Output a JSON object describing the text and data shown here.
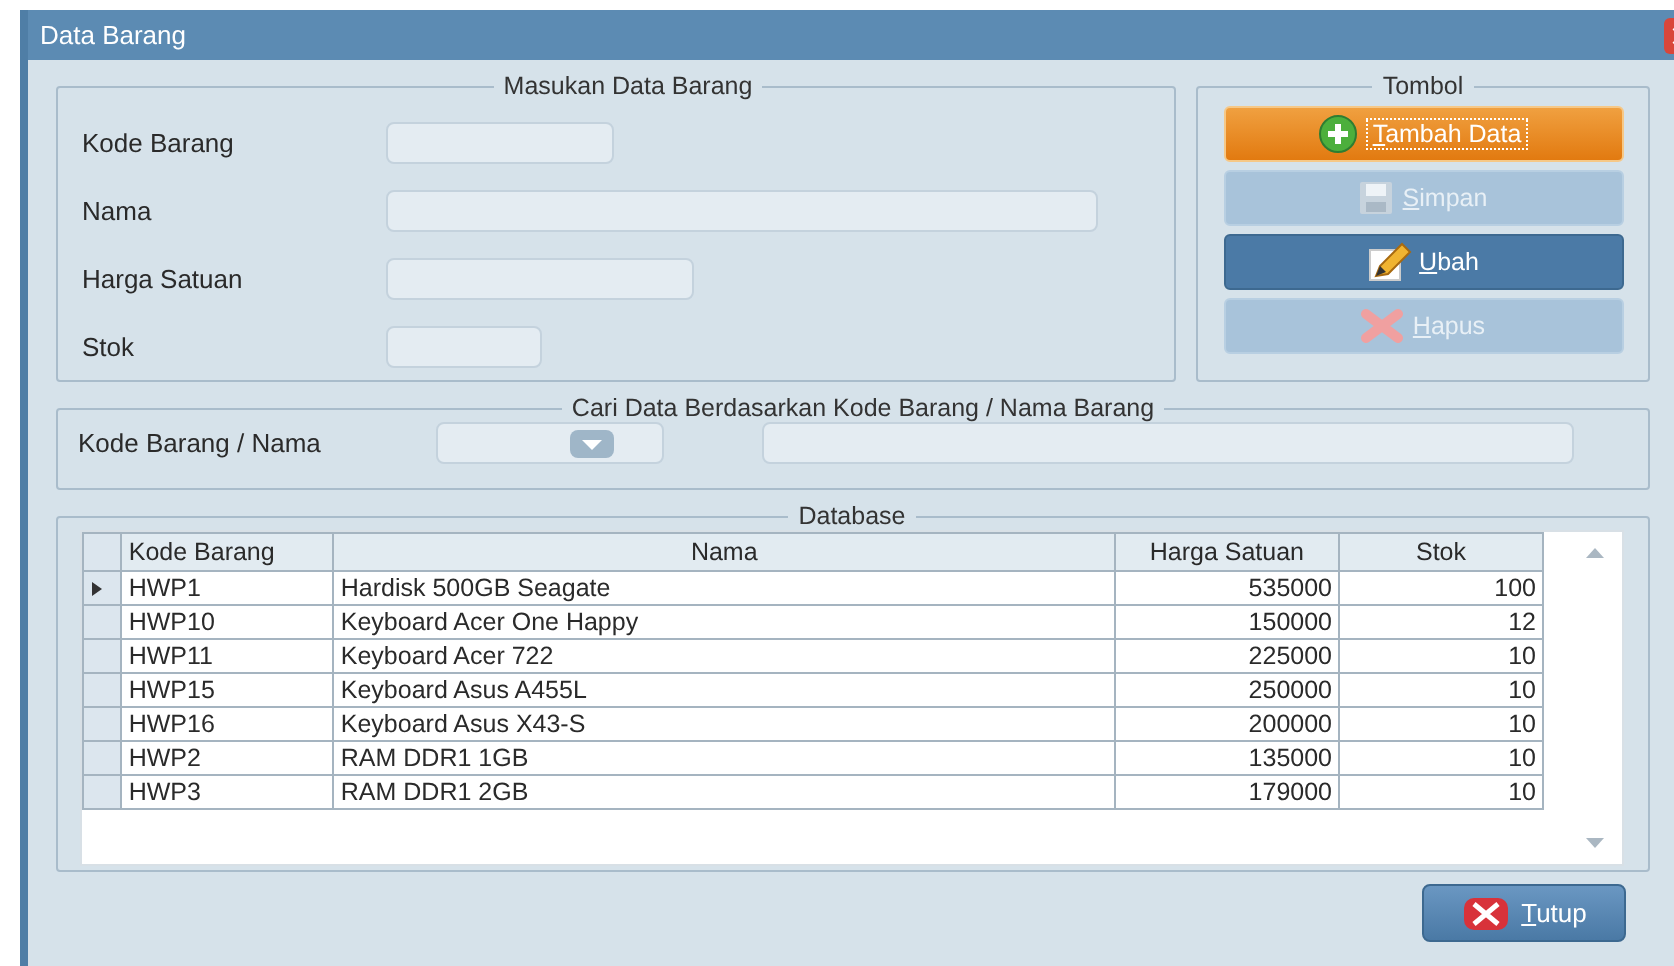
{
  "window": {
    "title": "Data Barang"
  },
  "input_group": {
    "title": "Masukan Data Barang",
    "fields": [
      {
        "label": "Kode Barang"
      },
      {
        "label": "Nama"
      },
      {
        "label": "Harga Satuan"
      },
      {
        "label": "Stok"
      }
    ]
  },
  "button_group": {
    "title": "Tombol",
    "buttons": [
      {
        "label": "Tambah Data",
        "highlighted": true,
        "disabled": false
      },
      {
        "label": "Simpan",
        "highlighted": false,
        "disabled": true
      },
      {
        "label": "Ubah",
        "highlighted": false,
        "disabled": false
      },
      {
        "label": "Hapus",
        "highlighted": false,
        "disabled": true
      }
    ]
  },
  "search_group": {
    "title": "Cari Data Berdasarkan Kode Barang / Nama Barang",
    "label": "Kode Barang / Nama"
  },
  "database": {
    "title": "Database",
    "columns": [
      "Kode Barang",
      "Nama",
      "Harga Satuan",
      "Stok"
    ],
    "rows": [
      {
        "cells": [
          "HWP1",
          "Hardisk 500GB Seagate",
          "535000",
          "100"
        ],
        "selected": true
      },
      {
        "cells": [
          "HWP10",
          "Keyboard Acer One Happy",
          "150000",
          "12"
        ],
        "selected": false
      },
      {
        "cells": [
          "HWP11",
          "Keyboard Acer 722",
          "225000",
          "10"
        ],
        "selected": false
      },
      {
        "cells": [
          "HWP15",
          "Keyboard Asus A455L",
          "250000",
          "10"
        ],
        "selected": false
      },
      {
        "cells": [
          "HWP16",
          "Keyboard Asus X43-S",
          "200000",
          "10"
        ],
        "selected": false
      },
      {
        "cells": [
          "HWP2",
          "RAM DDR1 1GB",
          "135000",
          "10"
        ],
        "selected": false
      },
      {
        "cells": [
          "HWP3",
          "RAM DDR1 2GB",
          "179000",
          "10"
        ],
        "selected": false
      }
    ]
  },
  "close_button": {
    "label": "Tutup"
  }
}
